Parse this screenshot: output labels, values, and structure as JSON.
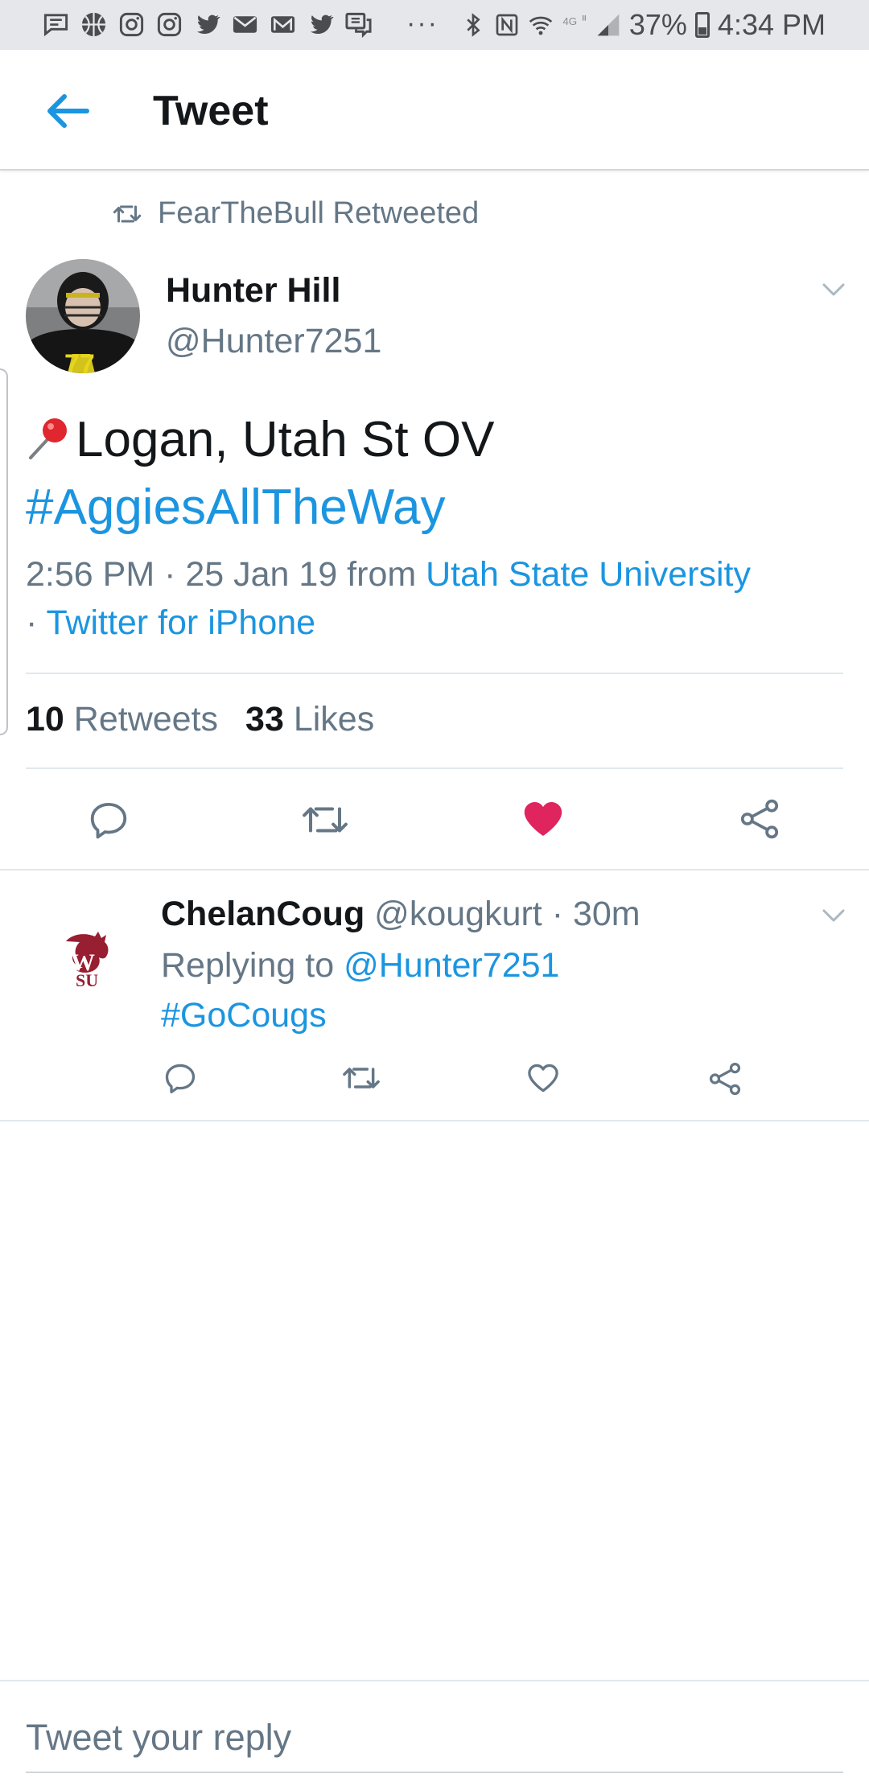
{
  "status_bar": {
    "icons": [
      "message-icon",
      "basketball-icon",
      "instagram-icon",
      "instagram-icon",
      "twitter-icon",
      "mail-icon",
      "gmail-icon",
      "twitter-icon",
      "chat-icon"
    ],
    "more": "···",
    "right_icons": [
      "bluetooth-icon",
      "nfc-icon",
      "wifi-icon",
      "4g-icon",
      "signal-icon"
    ],
    "battery": "37%",
    "time": "4:34 PM"
  },
  "app_bar": {
    "back_icon": "back-arrow-icon",
    "title": "Tweet"
  },
  "retweet_context": {
    "icon": "retweet-icon",
    "text": "FearTheBull Retweeted"
  },
  "tweet": {
    "author_name": "Hunter Hill",
    "author_handle": "@Hunter7251",
    "text_emoji": "pin-icon",
    "text": "Logan, Utah St OV",
    "hashtag": "#AggiesAllTheWay",
    "time_date": "2:56 PM · 25 Jan 19 from ",
    "location": "Utah State University",
    "separator": "· ",
    "source": "Twitter for iPhone",
    "retweets_count": "10",
    "retweets_label": "Retweets",
    "likes_count": "33",
    "likes_label": "Likes",
    "actions": [
      "reply-icon",
      "retweet-icon",
      "like-icon",
      "share-icon"
    ],
    "liked": true,
    "like_color": "#e0245e"
  },
  "reply": {
    "author_name": "ChelanCoug",
    "author_handle": "@kougkurt",
    "time": "· 30m",
    "replying_label": "Replying to ",
    "replying_handle": "@Hunter7251",
    "text": "#GoCougs",
    "avatar_color": "#981e32",
    "actions": [
      "reply-icon",
      "retweet-icon",
      "like-icon",
      "share-icon"
    ]
  },
  "compose": {
    "placeholder": "Tweet your reply"
  },
  "colors": {
    "accent": "#1b95e0",
    "muted": "#657786",
    "text": "#14171a"
  }
}
